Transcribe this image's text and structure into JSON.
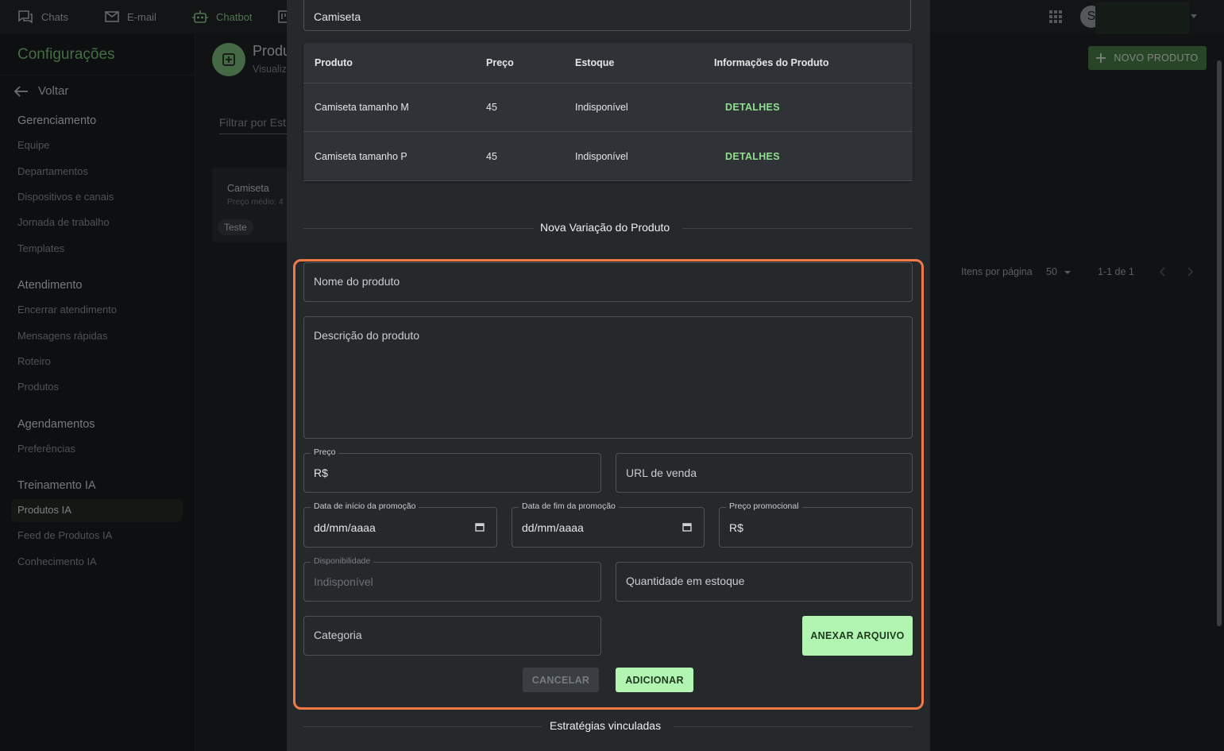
{
  "topbar": {
    "nav": [
      {
        "label": "Chats",
        "icon": "chat-icon"
      },
      {
        "label": "E-mail",
        "icon": "mail-icon"
      },
      {
        "label": "Chatbot",
        "icon": "robot-icon"
      }
    ],
    "avatar_initial": "S"
  },
  "sidebar": {
    "title": "Configurações",
    "back_label": "Voltar",
    "groups": [
      {
        "title": "Gerenciamento",
        "items": [
          "Equipe",
          "Departamentos",
          "Dispositivos e canais",
          "Jornada de trabalho",
          "Templates"
        ]
      },
      {
        "title": "Atendimento",
        "items": [
          "Encerrar atendimento",
          "Mensagens rápidas",
          "Roteiro",
          "Produtos"
        ]
      },
      {
        "title": "Agendamentos",
        "items": [
          "Preferências"
        ]
      },
      {
        "title": "Treinamento IA",
        "items": [
          "Produtos IA",
          "Feed de Produtos IA",
          "Conhecimento IA"
        ]
      }
    ],
    "active_item": "Produtos IA"
  },
  "page": {
    "title": "Produ",
    "subtitle": "Visualiz",
    "filter_placeholder": "Filtrar por Est",
    "card": {
      "title": "Camiseta",
      "subtitle": "Preço médio: 4",
      "chip": "Teste"
    },
    "new_button": "NOVO PRODUTO",
    "pager": {
      "items_per_page_label": "Itens por página",
      "items_per_page": "50",
      "range": "1-1 de 1"
    }
  },
  "dialog": {
    "product_name": "Camiseta",
    "table": {
      "headers": [
        "Produto",
        "Preço",
        "Estoque",
        "Informações do Produto"
      ],
      "rows": [
        {
          "produto": "Camiseta tamanho M",
          "preco": "45",
          "estoque": "Indisponível",
          "info": "DETALHES"
        },
        {
          "produto": "Camiseta tamanho P",
          "preco": "45",
          "estoque": "Indisponível",
          "info": "DETALHES"
        }
      ]
    },
    "new_variation_title": "Nova Variação do Produto",
    "form": {
      "nome_placeholder": "Nome do produto",
      "descricao_placeholder": "Descrição do produto",
      "preco_label": "Preço",
      "preco_value": "R$",
      "url_placeholder": "URL de venda",
      "inicio_label": "Data de início da promoção",
      "inicio_value": "dd/mm/aaaa",
      "fim_label": "Data de fim da promoção",
      "fim_value": "dd/mm/aaaa",
      "promo_label": "Preço promocional",
      "promo_value": "R$",
      "disp_label": "Disponibilidade",
      "disp_value": "Indisponível",
      "qtd_placeholder": "Quantidade em estoque",
      "categoria_placeholder": "Categoria",
      "anexar_label": "ANEXAR ARQUIVO",
      "cancelar_label": "CANCELAR",
      "adicionar_label": "ADICIONAR"
    },
    "strategies_title": "Estratégias vinculadas"
  },
  "colors": {
    "accent": "#7fc77f",
    "button_green": "#b2f5b2",
    "highlight": "#f07a45"
  }
}
